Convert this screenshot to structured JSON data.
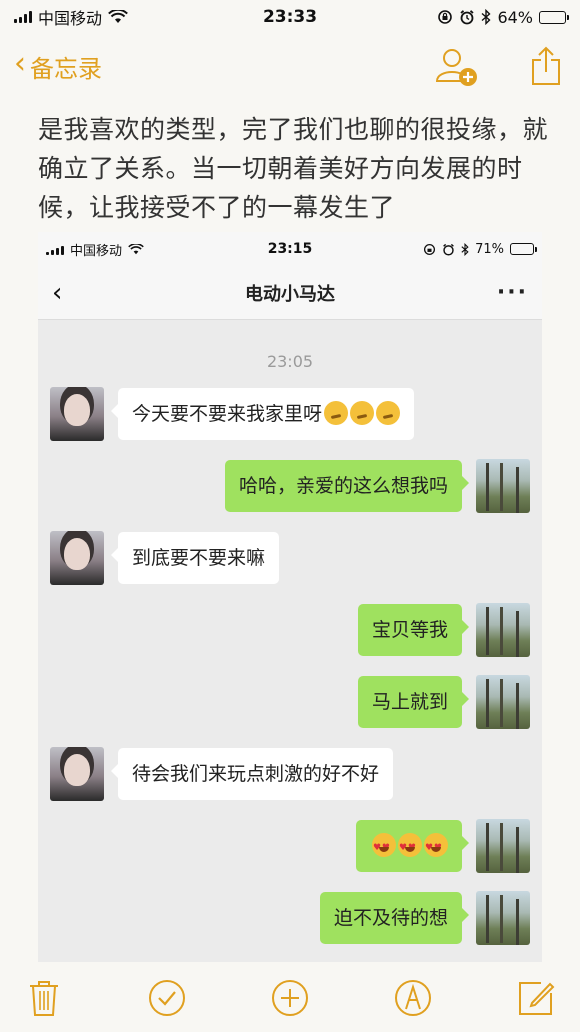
{
  "status_bar": {
    "carrier": "中国移动",
    "time": "23:33",
    "battery": "64%",
    "battery_level": 0.64
  },
  "notes_nav": {
    "back_label": "备忘录"
  },
  "notes_text": "是我喜欢的类型，完了我们也聊的很投缘，就确立了关系。当一切朝着美好方向发展的时候，让我接受不了的一幕发生了",
  "chat": {
    "status": {
      "carrier": "中国移动",
      "time": "23:15",
      "battery": "71%",
      "battery_level": 0.71
    },
    "title": "电动小马达",
    "timestamp": "23:05",
    "messages": [
      {
        "side": "left",
        "text": "今天要不要来我家里呀",
        "emojis": [
          "thinking-face",
          "thinking-face",
          "thinking-face"
        ]
      },
      {
        "side": "right",
        "text": "哈哈，亲爱的这么想我吗",
        "emojis": []
      },
      {
        "side": "left",
        "text": "到底要不要来嘛",
        "emojis": []
      },
      {
        "side": "right",
        "text": "宝贝等我",
        "emojis": []
      },
      {
        "side": "right",
        "text": "马上就到",
        "emojis": []
      },
      {
        "side": "left",
        "text": "待会我们来玩点刺激的好不好",
        "emojis": []
      },
      {
        "side": "right",
        "text": "",
        "emojis": [
          "heart-eyes-face",
          "heart-eyes-face",
          "heart-eyes-face"
        ]
      },
      {
        "side": "right",
        "text": "迫不及待的想",
        "emojis": []
      }
    ]
  },
  "toolbar": {
    "items": [
      "trash-icon",
      "checklist-icon",
      "add-icon",
      "markup-icon",
      "compose-icon"
    ]
  },
  "colors": {
    "accent": "#e0a020",
    "bubble_green": "#9fe15f",
    "page_bg": "#f8f7f3"
  }
}
